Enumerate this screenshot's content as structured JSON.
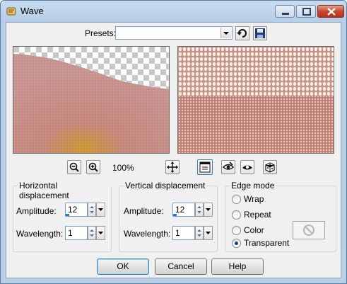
{
  "window": {
    "title": "Wave"
  },
  "presets": {
    "label": "Presets:",
    "value": ""
  },
  "zoom": {
    "level": "100%"
  },
  "horizontal": {
    "title": "Horizontal displacement",
    "amplitude_label": "Amplitude:",
    "amplitude": "12",
    "wavelength_label": "Wavelength:",
    "wavelength": "1"
  },
  "vertical": {
    "title": "Vertical displacement",
    "amplitude_label": "Amplitude:",
    "amplitude": "12",
    "wavelength_label": "Wavelength:",
    "wavelength": "1"
  },
  "edge_mode": {
    "title": "Edge mode",
    "options": [
      {
        "label": "Wrap",
        "checked": false
      },
      {
        "label": "Repeat",
        "checked": false
      },
      {
        "label": "Color",
        "checked": false
      },
      {
        "label": "Transparent",
        "checked": true
      }
    ]
  },
  "buttons": {
    "ok": "OK",
    "cancel": "Cancel",
    "help": "Help"
  },
  "colors": {
    "accent": "#1e7be0",
    "title_bar": "#b9cfe6"
  }
}
